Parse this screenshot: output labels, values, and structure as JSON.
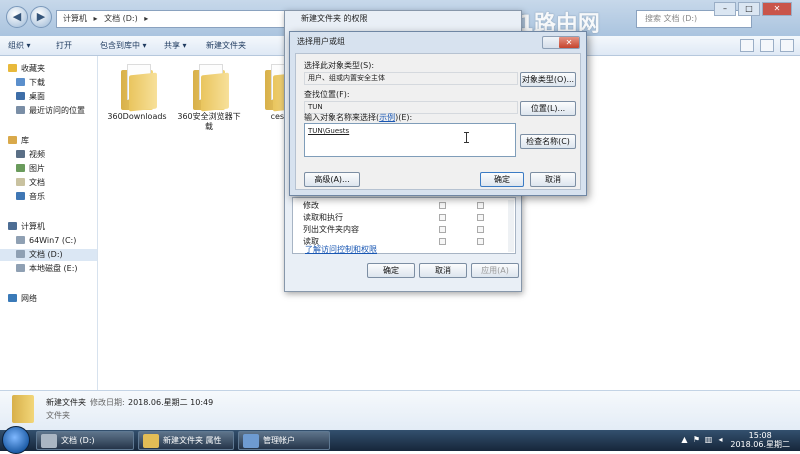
{
  "explorer": {
    "address_parts": [
      "计算机",
      "▸",
      "文档 (D:)",
      "▸"
    ],
    "search_placeholder": "搜索 文档 (D:)",
    "toolbar": {
      "organize": "组织 ▾",
      "open": "打开",
      "include_in_library": "包含到库中 ▾",
      "share": "共享 ▾",
      "new_folder": "新建文件夹"
    },
    "nav": {
      "favorites": "收藏夹",
      "downloads": "下载",
      "desktop": "桌面",
      "recent": "最近访问的位置",
      "libraries": "库",
      "videos": "视频",
      "pictures": "图片",
      "documents": "文档",
      "music": "音乐",
      "computer": "计算机",
      "drive_c": "64Win7 (C:)",
      "drive_d": "文档 (D:)",
      "drive_e": "本地磁盘 (E:)",
      "network": "网络"
    },
    "files": [
      "360Downloads",
      "360安全浏览器下载",
      "ceshi"
    ],
    "details": {
      "name": "新建文件夹",
      "modified_label": "修改日期:",
      "modified_value": "2018.06.星期二 10:49",
      "type": "文件夹"
    }
  },
  "properties": {
    "title": "新建文件夹 的权限",
    "perm_rows": [
      "修改",
      "读取和执行",
      "列出文件夹内容",
      "读取"
    ],
    "link": "了解访问控制和权限",
    "ok": "确定",
    "cancel": "取消",
    "apply": "应用(A)"
  },
  "dialog": {
    "title": "选择用户或组",
    "object_type_label": "选择此对象类型(S):",
    "object_type_value": "用户、组或内置安全主体",
    "object_type_button": "对象类型(O)...",
    "location_label": "查找位置(F):",
    "location_value": "TUN",
    "location_button": "位置(L)...",
    "enter_label_a": "输入对象名称来选择(",
    "enter_label_link": "示例",
    "enter_label_b": ")(E):",
    "entered_value": "TUN\\Guests",
    "check_names_button": "检查名称(C)",
    "advanced_button": "高级(A)...",
    "ok_button": "确定",
    "cancel_button": "取消"
  },
  "watermark": "191路由网",
  "taskbar": {
    "items": [
      "文档 (D:)",
      "新建文件夹 属性",
      "管理帐户"
    ],
    "time": "15:08",
    "date": "2018.06.星期二"
  }
}
